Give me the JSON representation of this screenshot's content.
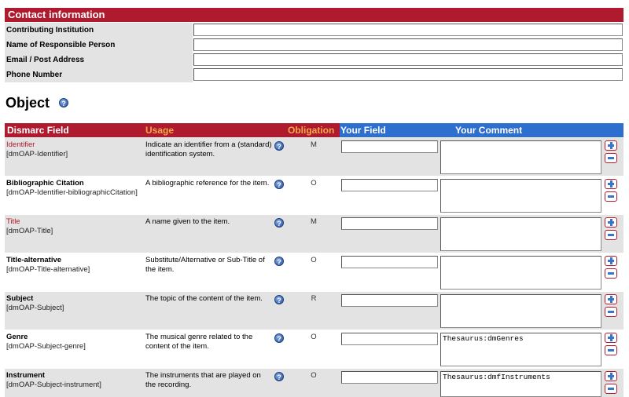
{
  "contact": {
    "title": "Contact information",
    "fields": [
      {
        "label": "Contributing Institution",
        "value": ""
      },
      {
        "label": "Name of Responsible Person",
        "value": ""
      },
      {
        "label": "Email / Post Address",
        "value": ""
      },
      {
        "label": "Phone Number",
        "value": ""
      }
    ]
  },
  "object": {
    "title": "Object",
    "help_glyph": "?",
    "columns": {
      "field": "Dismarc Field",
      "usage": "Usage",
      "obligation": "Obligation",
      "your_field": "Your Field",
      "your_comment": "Your Comment"
    },
    "rows": [
      {
        "name": "Identifier",
        "code": "[dmOAP-Identifier]",
        "mandatory": true,
        "usage": "Indicate an identifier from a (standard) identification system.",
        "obligation": "M",
        "your_field": "",
        "comment": ""
      },
      {
        "name": "Bibliographic Citation",
        "code": "[dmOAP-Identifier-bibliographicCitation]",
        "mandatory": false,
        "usage": "A bibliographic reference for the item.",
        "obligation": "O",
        "your_field": "",
        "comment": ""
      },
      {
        "name": "Title",
        "code": "[dmOAP-Title]",
        "mandatory": true,
        "usage": "A name given to the item.",
        "obligation": "M",
        "your_field": "",
        "comment": ""
      },
      {
        "name": "Title-alternative",
        "code": "[dmOAP-Title-alternative]",
        "mandatory": false,
        "usage": "Substitute/Alternative or Sub-Title of the item.",
        "obligation": "O",
        "your_field": "",
        "comment": ""
      },
      {
        "name": "Subject",
        "code": "[dmOAP-Subject]",
        "mandatory": false,
        "usage": "The topic of the content of the item.",
        "obligation": "R",
        "your_field": "",
        "comment": ""
      },
      {
        "name": "Genre",
        "code": "[dmOAP-Subject-genre]",
        "mandatory": false,
        "usage": "The musical genre related to the content of the item.",
        "obligation": "O",
        "your_field": "",
        "comment": "Thesaurus:dmGenres"
      },
      {
        "name": "Instrument",
        "code": "[dmOAP-Subject-instrument]",
        "mandatory": false,
        "usage": "The instruments that are played on the recording.",
        "obligation": "O",
        "your_field": "",
        "comment": "Thesaurus:dmfInstruments"
      }
    ]
  },
  "colors": {
    "header_red": "#b01a2e",
    "header_blue": "#2d6fce",
    "header_orange": "#f2a94a",
    "row_gray": "#e3e3e3"
  },
  "icons": {
    "help": "help-icon",
    "add": "plus-icon",
    "remove": "minus-icon"
  }
}
